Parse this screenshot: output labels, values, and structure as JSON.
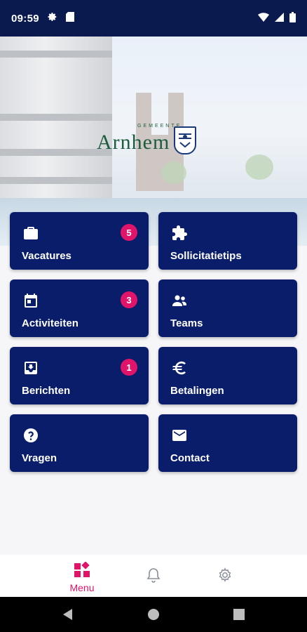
{
  "status_bar": {
    "time": "09:59",
    "left_icons": [
      "gear-icon",
      "sd-card-icon"
    ],
    "right_icons": [
      "wifi-icon",
      "signal-icon",
      "battery-icon"
    ]
  },
  "header": {
    "logo_small": "GEMEENTE",
    "logo_name": "Arnhem",
    "logo_icon": "coat-of-arms-icon"
  },
  "tiles": [
    {
      "label": "Vacatures",
      "icon": "briefcase-icon",
      "badge": "5"
    },
    {
      "label": "Sollicitatietips",
      "icon": "puzzle-icon",
      "badge": ""
    },
    {
      "label": "Activiteiten",
      "icon": "calendar-icon",
      "badge": "3"
    },
    {
      "label": "Teams",
      "icon": "people-icon",
      "badge": ""
    },
    {
      "label": "Berichten",
      "icon": "inbox-icon",
      "badge": "1"
    },
    {
      "label": "Betalingen",
      "icon": "euro-icon",
      "badge": ""
    },
    {
      "label": "Vragen",
      "icon": "help-circle-icon",
      "badge": ""
    },
    {
      "label": "Contact",
      "icon": "mail-icon",
      "badge": ""
    }
  ],
  "bottom_nav": {
    "menu_label": "Menu",
    "items": [
      "menu-grid-icon",
      "bell-icon",
      "gear-icon"
    ]
  },
  "system_nav": [
    "back-icon",
    "home-icon",
    "recents-icon"
  ],
  "colors": {
    "status_bar": "#0a1a4e",
    "tile": "#0a1d6b",
    "badge": "#e0156a",
    "accent": "#e0156a",
    "logo_green": "#1d5d3e",
    "background": "#f6f6f8"
  }
}
